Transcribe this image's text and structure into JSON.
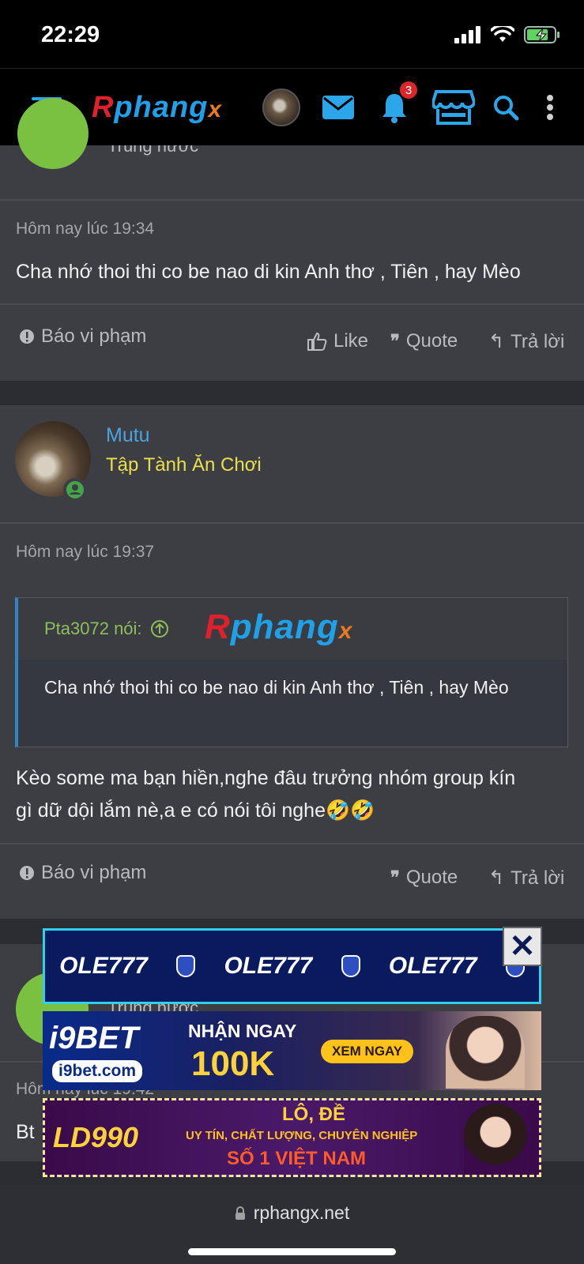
{
  "status": {
    "time": "22:29"
  },
  "nav": {
    "logo_r": "R",
    "logo_main": "phang",
    "logo_x": "x",
    "notification_count": "3"
  },
  "posts": [
    {
      "rank": "Trùng nước",
      "timestamp": "Hôm nay lúc 19:34",
      "text": "Cha nhớ thoi thi co be nao di kin Anh thơ , Tiên , hay Mèo",
      "report": "Báo vi phạm",
      "like": "Like",
      "quote": "Quote",
      "reply": "Trả lời"
    },
    {
      "username": "Mutu",
      "rank": "Tập Tành Ăn Chơi",
      "timestamp": "Hôm nay lúc 19:37",
      "quote_author": "Pta3072 nói:",
      "quote_text": "Cha nhớ thoi thi co be nao di kin Anh thơ , Tiên , hay Mèo",
      "text_line1": "Kèo some ma bạn hiền,nghe đâu trưởng nhóm group kín",
      "text_line2": "gì dữ dội lắm nè,a e có nói tôi nghe🤣🤣",
      "report": "Báo vi phạm",
      "quote": "Quote",
      "reply": "Trả lời"
    },
    {
      "rank": "Trùng nước",
      "timestamp": "Hôm nay lúc 19:42",
      "text": "Bt"
    }
  ],
  "watermark": {
    "r": "R",
    "main": "phang",
    "x": "x"
  },
  "ads": {
    "ole_brand": "OLE777",
    "i9_brand": "i9BET",
    "i9_site": "i9bet.com",
    "i9_headline": "NHẬN NGAY",
    "i9_amount": "100K",
    "i9_cta": "XEM NGAY",
    "ld_brand": "LD990",
    "ld_title": "LÔ, ĐỀ",
    "ld_tagline": "UY TÍN, CHẤT LƯỢNG, CHUYÊN NGHIỆP",
    "ld_slogan": "SỐ 1 VIỆT NAM"
  },
  "browser": {
    "url": "rphangx.net"
  },
  "colors": {
    "link": "#4aa3df",
    "rank_yellow": "#e8e04a",
    "quote_green": "#8fbe5a",
    "accent_blue": "#1fa0e8"
  }
}
